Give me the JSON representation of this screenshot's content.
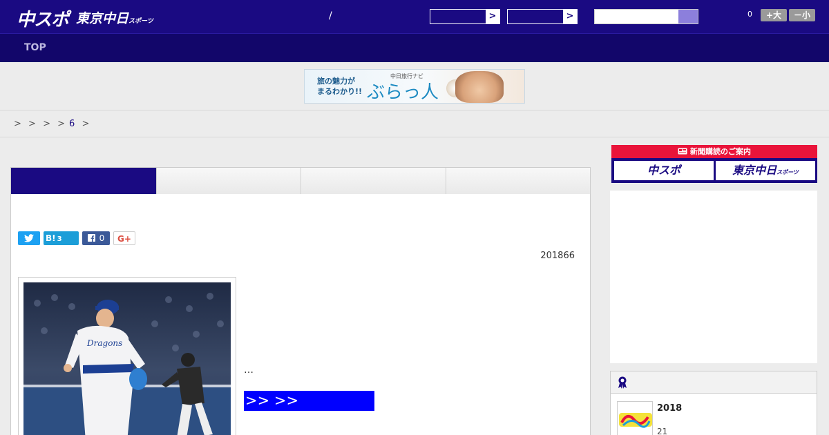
{
  "header": {
    "logo_main": "中スポ",
    "logo_sub": "東京中日",
    "logo_sub_small": "スポーツ",
    "separator": "/",
    "select_arrow": ">",
    "counter": "0",
    "font_larger": "+大",
    "font_smaller": "－小"
  },
  "nav": {
    "top_label": "TOP"
  },
  "banner": {
    "line1": "旅の魅力が",
    "line2": "まるわかり!!",
    "small": "中日旅行ナビ",
    "brand": "ぶらっ人"
  },
  "breadcrumb": {
    "separators": [
      ">",
      ">",
      ">",
      ">"
    ],
    "current": "6",
    "trail": ">"
  },
  "article": {
    "share": {
      "hatena_label": "B!",
      "hatena_count": "3",
      "facebook_count": "0",
      "gplus_label": "G+"
    },
    "date": "201866",
    "excerpt": "…",
    "more_link": ">> >>"
  },
  "sidebar": {
    "subscribe_head": "新聞購読のご案内",
    "subscribe_a": "中スポ",
    "subscribe_b": "東京中日",
    "subscribe_b_small": "スポーツ",
    "ranking": {
      "item_title": "2018",
      "item_sub": "21"
    }
  },
  "colors": {
    "brand": "#1a0a82",
    "accent_red": "#e9143a",
    "link_blue": "#0000ff"
  }
}
